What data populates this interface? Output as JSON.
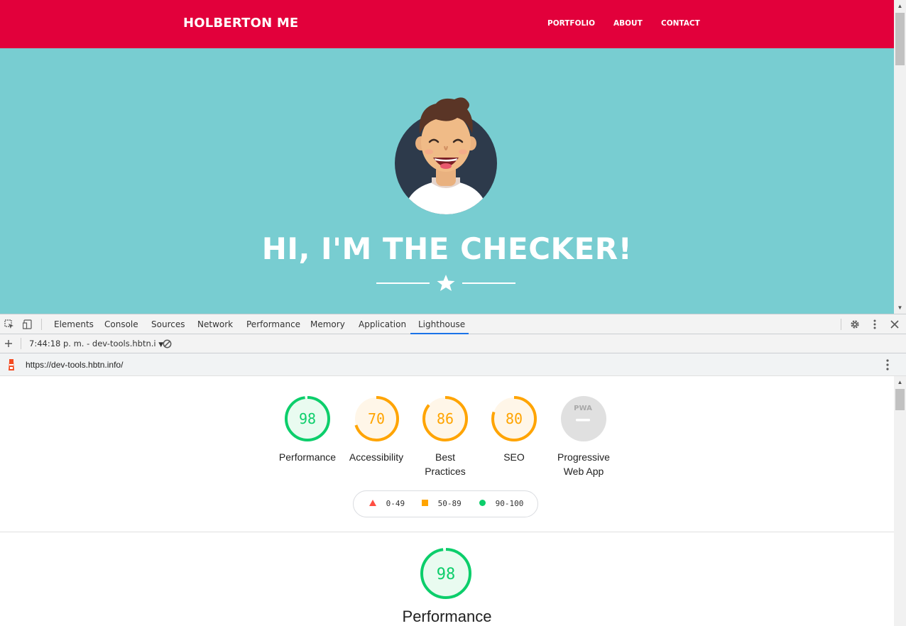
{
  "site": {
    "brand": "HOLBERTON ME",
    "nav": [
      "PORTFOLIO",
      "ABOUT",
      "CONTACT"
    ],
    "hero_title": "HI, I'M THE CHECKER!"
  },
  "devtools": {
    "tabs": [
      "Elements",
      "Console",
      "Sources",
      "Network",
      "Performance",
      "Memory",
      "Application",
      "Lighthouse"
    ],
    "active_tab": "Lighthouse",
    "report_selector": "7:44:18 p. m. - dev-tools.hbtn.i",
    "url": "https://dev-tools.hbtn.info/"
  },
  "lighthouse": {
    "categories": [
      {
        "score": "98",
        "label": "Performance",
        "color": "#0cce6b"
      },
      {
        "score": "70",
        "label": "Accessibility",
        "color": "#ffa400"
      },
      {
        "score": "86",
        "label": "Best Practices",
        "color": "#ffa400"
      },
      {
        "score": "80",
        "label": "SEO",
        "color": "#ffa400"
      },
      {
        "score": "",
        "label": "Progressive Web App",
        "badge": "PWA"
      }
    ],
    "legend": [
      {
        "range": "0-49",
        "color": "#ff4e42"
      },
      {
        "range": "50-89",
        "color": "#ffa400"
      },
      {
        "range": "90-100",
        "color": "#0cce6b"
      }
    ],
    "detail": {
      "score": "98",
      "title": "Performance",
      "color": "#0cce6b"
    }
  }
}
